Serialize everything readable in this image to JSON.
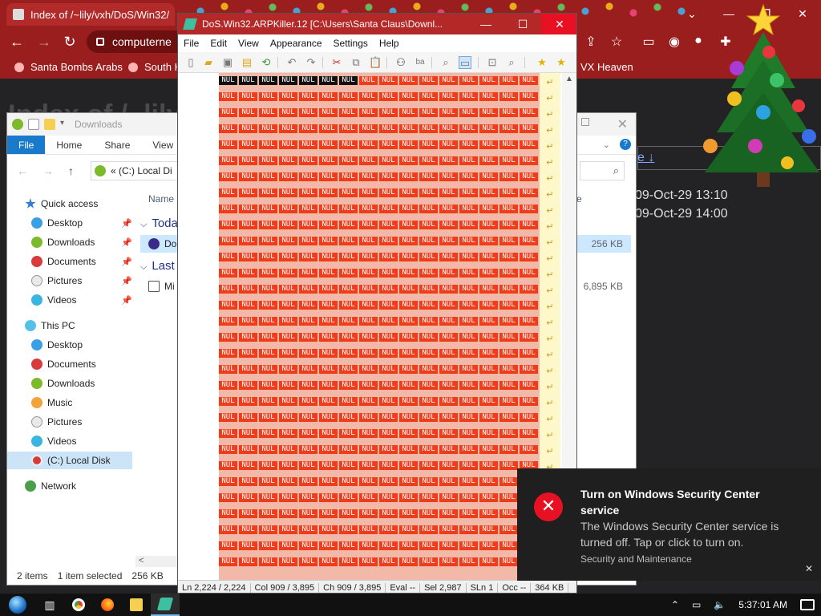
{
  "chrome": {
    "tab_title": "Index of /~lily/vxh/DoS/Win32/",
    "url_text": "computerne",
    "bookmarks": [
      "Santa Bombs Arabs",
      "South H",
      "VX Heaven"
    ],
    "page_heading": "Index of /~lily/",
    "page_link": "e ↓",
    "page_rows": [
      "09-Oct-29 13:10",
      "09-Oct-29 14:00"
    ],
    "accent": "#9a1e1e"
  },
  "explorer": {
    "title": "Downloads",
    "ribbon_tabs": [
      "File",
      "Home",
      "Share",
      "View"
    ],
    "address_text": "« (C:) Local Di",
    "column_name": "Name",
    "column_size_partial": "e",
    "groups": [
      "Toda",
      "Last"
    ],
    "files": [
      {
        "name": "Do",
        "size": "256 KB"
      },
      {
        "name": "Mi",
        "size": "6,895 KB"
      }
    ],
    "quick_access_label": "Quick access",
    "quick_access": [
      "Desktop",
      "Downloads",
      "Documents",
      "Pictures",
      "Videos"
    ],
    "this_pc_label": "This PC",
    "this_pc": [
      "Desktop",
      "Documents",
      "Downloads",
      "Music",
      "Pictures",
      "Videos",
      "(C:) Local Disk"
    ],
    "network_label": "Network",
    "status_items": "2 items",
    "status_selected": "1 item selected",
    "status_size": "256 KB",
    "hscroll_left": "<"
  },
  "hexeditor": {
    "title": "DoS.Win32.ARPKiller.12 [C:\\Users\\Santa Claus\\Downl...",
    "menu": [
      "File",
      "Edit",
      "View",
      "Appearance",
      "Settings",
      "Help"
    ],
    "cell_text": "NUL",
    "status": {
      "ln": "Ln  2,224 / 2,224",
      "col": "Col  909 / 3,895",
      "ch": "Ch  909 / 3,895",
      "eval": "Eval  --",
      "sel": "Sel  2,987",
      "sln": "SLn  1",
      "occ": "Occ  --",
      "size": "364 KB"
    },
    "null_color": "#ef3d1c"
  },
  "toast": {
    "title": "Turn on Windows Security Center service",
    "body": "The Windows Security Center service is turned off. Tap or click to turn on.",
    "source": "Security and Maintenance",
    "icon": "close-x-icon",
    "accent": "#e81123"
  },
  "taskbar": {
    "time": "5:37:01 AM",
    "apps": [
      "task-view-icon",
      "chrome-icon",
      "firefox-icon",
      "file-explorer-icon",
      "hex-editor-icon"
    ]
  }
}
